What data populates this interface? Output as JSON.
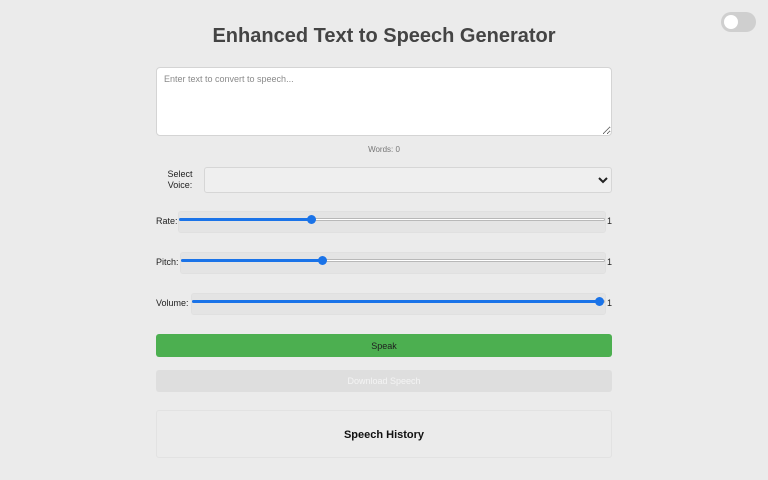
{
  "header": {
    "title": "Enhanced Text to Speech Generator",
    "theme_toggle_on": false
  },
  "text_input": {
    "value": "",
    "placeholder": "Enter text to convert to speech..."
  },
  "word_count": "Words: 0",
  "voice": {
    "label": "Select Voice:",
    "selected": ""
  },
  "sliders": {
    "rate": {
      "label": "Rate:",
      "value": "1",
      "min": 0.1,
      "max": 3,
      "current": 1
    },
    "pitch": {
      "label": "Pitch:",
      "value": "1",
      "min": 0,
      "max": 3,
      "current": 1
    },
    "volume": {
      "label": "Volume:",
      "value": "1",
      "min": 0,
      "max": 1,
      "current": 1
    }
  },
  "buttons": {
    "speak_label": "Speak",
    "download_label": "Download Speech"
  },
  "history": {
    "title": "Speech History"
  },
  "colors": {
    "accent": "#1a73e8",
    "speak": "#4caf50",
    "background": "#ebebeb"
  }
}
